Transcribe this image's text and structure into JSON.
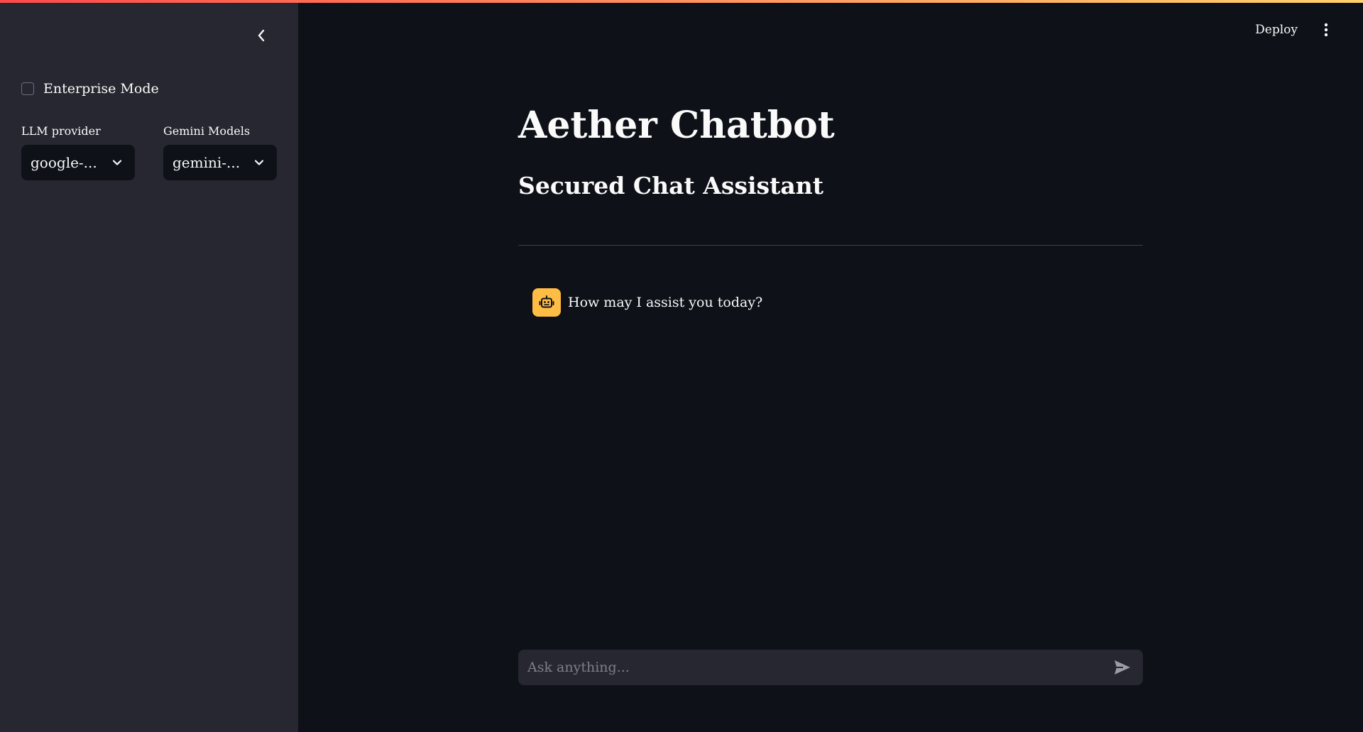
{
  "colors": {
    "accent_gradient": [
      "#ff4b4b",
      "#ff8a5c",
      "#ffd16a"
    ],
    "sidebar_bg": "#262730",
    "main_bg": "#0e1117",
    "avatar_bg": "#ffbd45"
  },
  "sidebar": {
    "collapse_icon": "chevron-left-icon",
    "enterprise_mode": {
      "label": "Enterprise Mode",
      "checked": false
    },
    "llm_provider": {
      "label": "LLM provider",
      "value": "google-..."
    },
    "gemini_models": {
      "label": "Gemini Models",
      "value": "gemini-..."
    }
  },
  "header": {
    "deploy_label": "Deploy",
    "menu_icon": "more-vertical-icon"
  },
  "main": {
    "title": "Aether Chatbot",
    "subtitle": "Secured Chat Assistant",
    "messages": [
      {
        "role": "assistant",
        "avatar_icon": "robot-icon",
        "text": "How may I assist you today?"
      }
    ],
    "chat_input": {
      "placeholder": "Ask anything...",
      "value": "",
      "send_icon": "send-icon"
    }
  }
}
